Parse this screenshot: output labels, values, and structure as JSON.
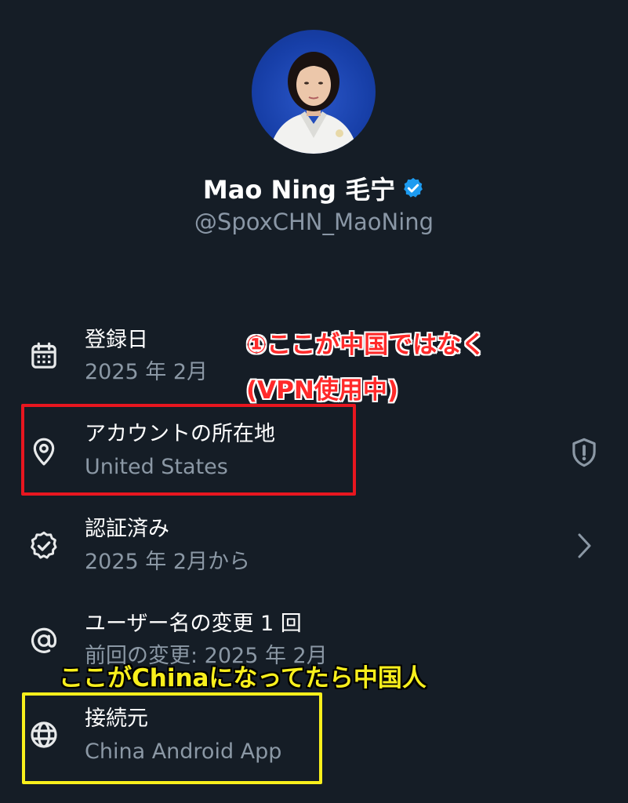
{
  "profile": {
    "display_name": "Mao Ning 毛宁",
    "handle": "@SpoxCHN_MaoNing",
    "verified_color": "#1d9bf0"
  },
  "rows": [
    {
      "icon": "calendar-icon",
      "title": "登録日",
      "subtitle": "2025 年 2月"
    },
    {
      "icon": "location-pin-icon",
      "title": "アカウントの所在地",
      "subtitle": "United States",
      "trailing_icon": "shield-alert-icon"
    },
    {
      "icon": "verified-badge-outline-icon",
      "title": "認証済み",
      "subtitle": "2025 年 2月から",
      "trailing_icon": "chevron-right-icon"
    },
    {
      "icon": "at-sign-icon",
      "title": "ユーザー名の変更 1 回",
      "subtitle": "前回の変更: 2025 年 2月"
    },
    {
      "icon": "globe-icon",
      "title": "接続元",
      "subtitle": "China Android App"
    }
  ],
  "annotations": {
    "red_note_line1": "①ここが中国ではなく",
    "red_note_line2": "(VPN使用中)",
    "yellow_note": "ここがChinaになってたら中国人",
    "red_color": "#e8161f",
    "yellow_color": "#f8ef1c"
  },
  "colors": {
    "background": "#151d26",
    "primary_text": "#ffffff",
    "secondary_text": "#8b98a5"
  }
}
